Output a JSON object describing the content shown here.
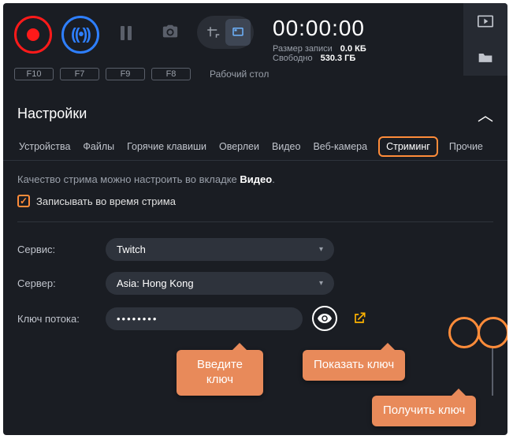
{
  "top": {
    "timer": "00:00:00",
    "size_label": "Размер записи",
    "size_value": "0.0 КБ",
    "free_label": "Свободно",
    "free_value": "530.3 ГБ",
    "hk_rec": "F10",
    "hk_stream": "F7",
    "hk_pause": "F9",
    "hk_shot": "F8",
    "screen_label": "Рабочий стол"
  },
  "section_title": "Настройки",
  "tabs": {
    "devices": "Устройства",
    "files": "Файлы",
    "hotkeys": "Горячие клавиши",
    "overlays": "Оверлеи",
    "video": "Видео",
    "webcam": "Веб-камера",
    "streaming": "Стриминг",
    "other": "Прочие"
  },
  "hint_prefix": "Качество стрима можно настроить во вкладке ",
  "hint_bold": "Видео",
  "record_during_stream": "Записывать во время стрима",
  "form": {
    "service_label": "Сервис:",
    "service_value": "Twitch",
    "server_label": "Сервер:",
    "server_value": "Asia: Hong Kong",
    "key_label": "Ключ потока:",
    "key_value": "••••••••"
  },
  "callouts": {
    "enter_key": "Введите ключ",
    "show_key": "Показать ключ",
    "get_key": "Получить ключ"
  }
}
